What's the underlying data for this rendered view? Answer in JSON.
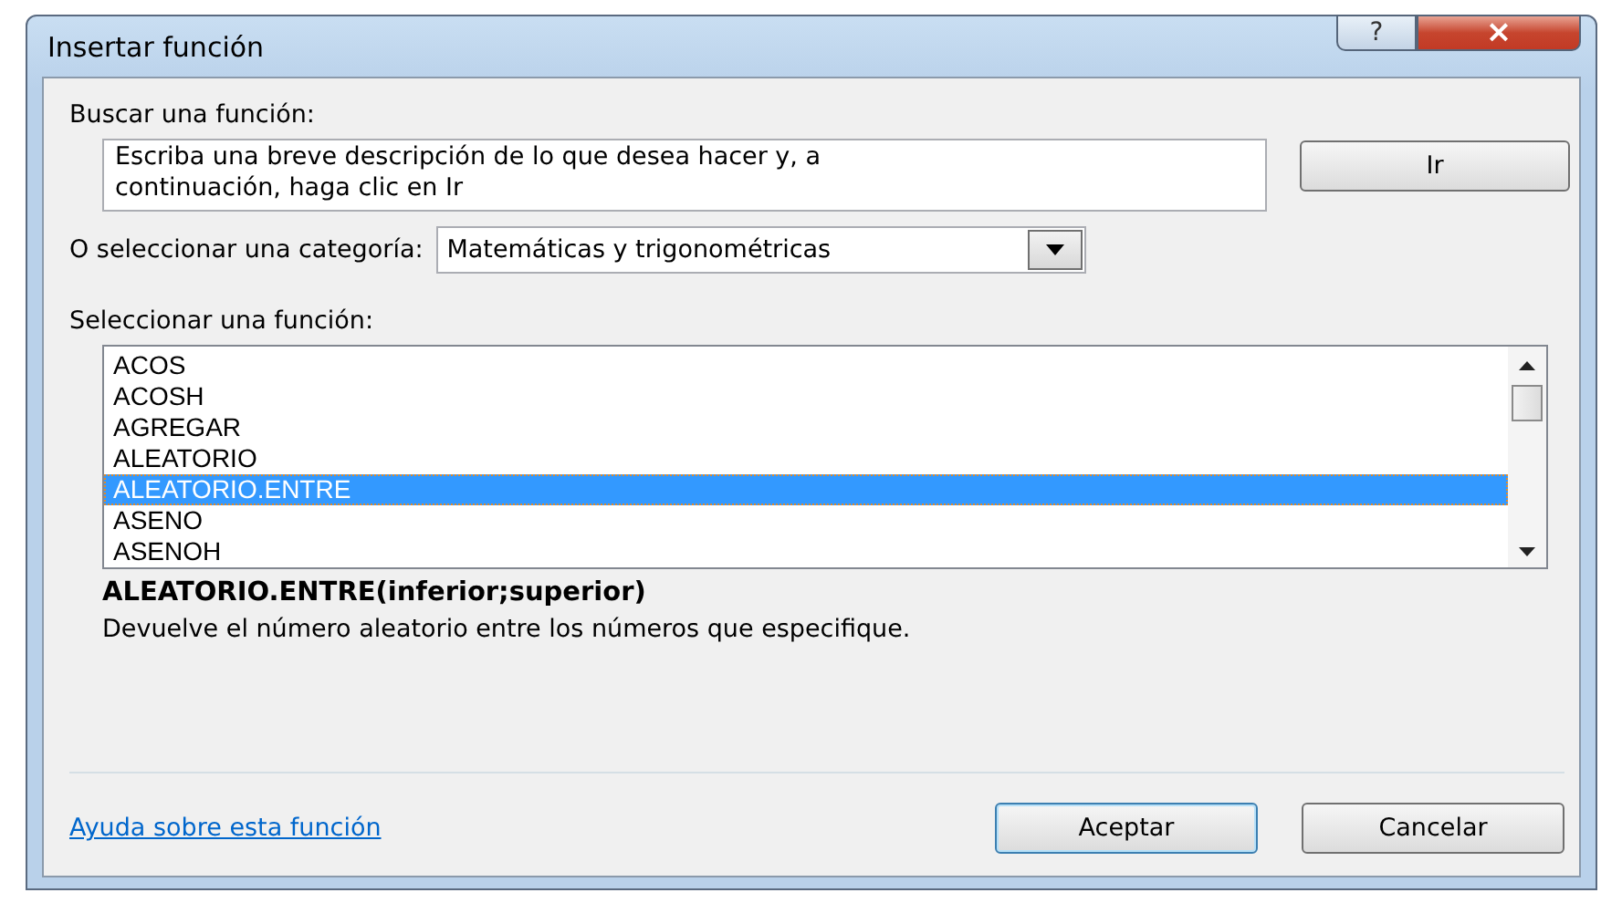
{
  "window": {
    "title": "Insertar función",
    "help_button": "?",
    "close_button": "×"
  },
  "search": {
    "label": "Buscar una función:",
    "placeholder": "Escriba una breve descripción de lo que desea hacer y, a\ncontinuación, haga clic en Ir",
    "button": "Ir"
  },
  "category": {
    "label": "O seleccionar una categoría:",
    "value": "Matemáticas y trigonométricas"
  },
  "function_list": {
    "label": "Seleccionar una función:",
    "items": [
      {
        "name": "ACOS",
        "selected": false
      },
      {
        "name": "ACOSH",
        "selected": false
      },
      {
        "name": "AGREGAR",
        "selected": false
      },
      {
        "name": "ALEATORIO",
        "selected": false
      },
      {
        "name": "ALEATORIO.ENTRE",
        "selected": true
      },
      {
        "name": "ASENO",
        "selected": false
      },
      {
        "name": "ASENOH",
        "selected": false
      }
    ]
  },
  "signature": "ALEATORIO.ENTRE(inferior;superior)",
  "description": "Devuelve el número aleatorio entre los números que especifique.",
  "help_link": "Ayuda sobre esta función",
  "buttons": [
    {
      "label": "Aceptar",
      "default": true
    },
    {
      "label": "Cancelar",
      "default": false
    }
  ]
}
